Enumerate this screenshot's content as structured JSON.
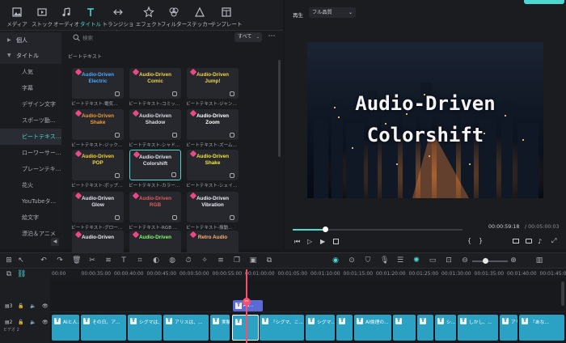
{
  "toolbar": {
    "items": [
      {
        "label": "メディア",
        "icon": "media-icon"
      },
      {
        "label": "ストック",
        "icon": "stock-icon"
      },
      {
        "label": "オーディオ",
        "icon": "audio-icon"
      },
      {
        "label": "タイトル",
        "icon": "title-icon"
      },
      {
        "label": "トランジション",
        "icon": "transition-icon"
      },
      {
        "label": "エフェクト",
        "icon": "effect-icon"
      },
      {
        "label": "フィルター",
        "icon": "filter-icon"
      },
      {
        "label": "ステッカー",
        "icon": "sticker-icon"
      },
      {
        "label": "テンプレート",
        "icon": "template-icon"
      }
    ],
    "active_index": 3
  },
  "categories": {
    "items": [
      {
        "label": "個人",
        "kind": "head",
        "chev": "▶"
      },
      {
        "label": "タイトル",
        "kind": "head",
        "chev": "▼"
      },
      {
        "label": "人気",
        "kind": "item"
      },
      {
        "label": "字幕",
        "kind": "item"
      },
      {
        "label": "デザイン文字",
        "kind": "item"
      },
      {
        "label": "スポーツ動...",
        "kind": "item"
      },
      {
        "label": "ビートテキス...",
        "kind": "selected"
      },
      {
        "label": "ローワーサー...",
        "kind": "item"
      },
      {
        "label": "プレーンテキ...",
        "kind": "item"
      },
      {
        "label": "花火",
        "kind": "item"
      },
      {
        "label": "YouTubeタ...",
        "kind": "item"
      },
      {
        "label": "絵文字",
        "kind": "item"
      },
      {
        "label": "漂泊＆アニメ",
        "kind": "item"
      }
    ]
  },
  "search": {
    "placeholder": "検索",
    "filter_value": "すべて"
  },
  "section_title": "ビートテキスト",
  "cards": [
    {
      "text": "Audio-Driven\nElectric",
      "caption": "ビートテキスト-電気...",
      "color": "#4aa8ff"
    },
    {
      "text": "Audio-Driven\nComic",
      "caption": "ビートテキスト-コミッ...",
      "color": "#f2d14b"
    },
    {
      "text": "Audio-Driven\nJump!",
      "caption": "ビートテキスト-ジャン...",
      "color": "#f0d44a"
    },
    {
      "text": "Audio-Driven\nShake",
      "caption": "ビートテキスト-ジック...",
      "color": "#f29a2c"
    },
    {
      "text": "Audio-Driven\nShadow",
      "caption": "ビートテキスト-シャド...",
      "color": "#d9dde3"
    },
    {
      "text": "Audio-Driven\nZoom",
      "caption": "ビートテキスト-ズーム...",
      "color": "#ffffff"
    },
    {
      "text": "Audio-Driven\nPOP",
      "caption": "ビートテキスト-ポップ...",
      "color": "#f5d532"
    },
    {
      "text": "Audio-Driven\nColorshift",
      "caption": "ビートテキスト-カラー...",
      "color": "#dfe3ea"
    },
    {
      "text": "Audio-Driven\nShake",
      "caption": "ビートテキスト-シェイ...",
      "color": "#f3e33a"
    },
    {
      "text": "Audio-Driven\nGlow",
      "caption": "ビートテキスト-グロー...",
      "color": "#e2e6ed"
    },
    {
      "text": "Audio-Driven\nRGB",
      "caption": "ビートテキスト-RGB ...",
      "color": "#e45a5a"
    },
    {
      "text": "Audio-Driven\nVibration",
      "caption": "ビートテキスト-振動...",
      "color": "#e8ecf2"
    },
    {
      "text": "Audio-Driven",
      "caption": "",
      "color": "#e8ecf2"
    },
    {
      "text": "Audio-Driven",
      "caption": "",
      "color": "#7cff6a"
    },
    {
      "text": "Retro Audio",
      "caption": "",
      "color": "#ffb26b"
    }
  ],
  "preview": {
    "mode_label": "再生",
    "quality": "フル品質",
    "title_line1": "Audio-Driven",
    "title_line2": "Colorshift",
    "current_time": "00:00:59:18",
    "total_time": "/ 00:05:00:03",
    "progress": 0.19
  },
  "ruler": [
    "00:00",
    "00:00:35:00",
    "00:00:40:00",
    "00:00:45:00",
    "00:00:50:00",
    "00:00:55:00",
    "00:01:00:00",
    "00:01:05:00",
    "00:01:10:00",
    "00:01:15:00",
    "00:01:20:00",
    "00:01:25:00",
    "00:01:30:00",
    "00:01:35:00",
    "00:01:40:00",
    "00:01:45:00"
  ],
  "tracks": {
    "label3": "3",
    "label2": "2",
    "sub2": "ビデオ 2"
  },
  "title_clip": "Au...",
  "clips": [
    "AIと人...",
    "その日、ア...",
    "シグマは、...",
    "アリスは、...",
    "実験...",
    "",
    "「シグマ、こ...",
    "シグマ...",
    "",
    "AI倫理の...",
    "",
    "",
    "シ...",
    "しかし、...",
    "アリ...",
    "「あな..."
  ]
}
